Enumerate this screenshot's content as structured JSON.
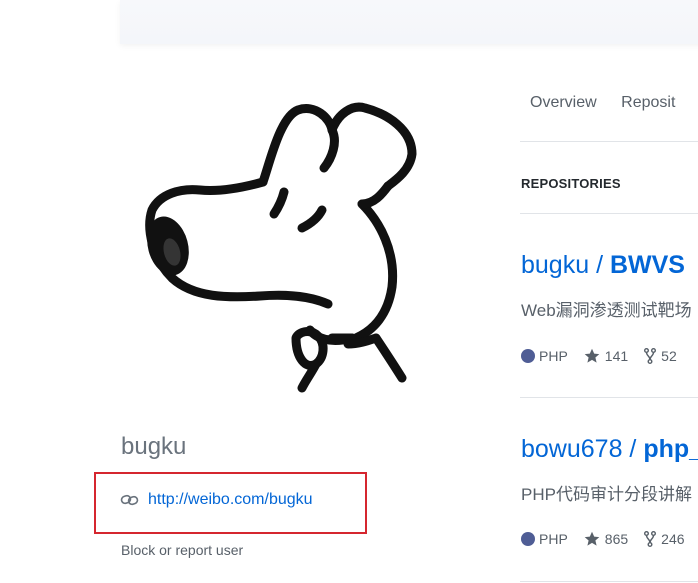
{
  "profile": {
    "name": "bugku",
    "link_text": "http://weibo.com/bugku",
    "block_text": "Block or report user",
    "avatar_icon": "dog-sketch-avatar",
    "link_icon": "link-icon"
  },
  "nav": {
    "tabs": [
      {
        "label": "Overview"
      },
      {
        "label": "Reposit"
      }
    ]
  },
  "repositories": {
    "section_title": "REPOSITORIES",
    "items": [
      {
        "owner": "bugku",
        "separator": " / ",
        "name": "BWVS",
        "description": "Web漏洞渗透测试靶场",
        "language": "PHP",
        "language_color": "#4F5D95",
        "stars": "141",
        "forks": "52"
      },
      {
        "owner": "bowu678",
        "separator": " / ",
        "name": "php_",
        "description": "PHP代码审计分段讲解",
        "language": "PHP",
        "language_color": "#4F5D95",
        "stars": "865",
        "forks": "246"
      }
    ]
  },
  "colors": {
    "link": "#0366d6",
    "highlight": "#d5262f",
    "muted": "#586069"
  }
}
